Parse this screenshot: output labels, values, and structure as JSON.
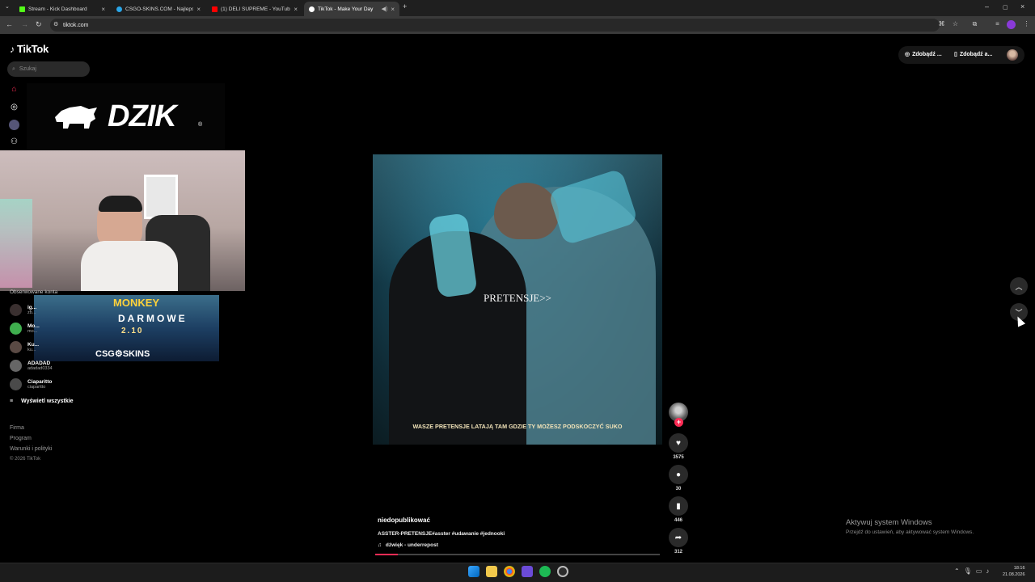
{
  "browser": {
    "tabs": [
      {
        "title": "Stream - Kick Dashboard",
        "color": "#53fc18"
      },
      {
        "title": "CSGO-SKINS.COM - Najlepsze",
        "color": "#2aa6e8"
      },
      {
        "title": "(1) DELI SUPREME - YouTube",
        "color": "#ff0000"
      },
      {
        "title": "TikTok - Make Your Day",
        "color": "#ffffff"
      }
    ],
    "new_tab": "+",
    "url": "tiktok.com"
  },
  "tiktok": {
    "logo": "TikTok",
    "search_placeholder": "Szukaj",
    "followed_label": "Obserwowane konta",
    "accounts": [
      {
        "name": "ig...",
        "handle": "zb..."
      },
      {
        "name": "Mo...",
        "handle": "mo..."
      },
      {
        "name": "Ku...",
        "handle": "ku..."
      },
      {
        "name": "ADADAD",
        "handle": "adadad0334"
      },
      {
        "name": "Ciaparitto",
        "handle": "ciaparitto"
      }
    ],
    "show_all": "Wyświetl wszystkie",
    "footer": {
      "firma": "Firma",
      "program": "Program",
      "terms": "Warunki i polityki",
      "copyright": "© 2026 TikTok"
    },
    "top_buttons": {
      "get_coins": "Zdobądź ...",
      "get_app": "Zdobądź a..."
    }
  },
  "overlays": {
    "dzik": {
      "text": "DZIK",
      "reg": "®"
    },
    "csgo": {
      "top": "MONKEY",
      "darmowe": "DARMOWE",
      "number": "2.10",
      "brand": "CSG⚙SKINS"
    }
  },
  "video": {
    "overlay_text": "PRETENSJE>>",
    "subtitle": "WASZE PRETENSJE LATAJĄ TAM GDZIE TY MOŻESZ PODSKOCZYĆ SUKO",
    "author": "niedopublikować",
    "description": "ASSTER-PRETENSJE#asster #udawanie #jednooki",
    "music": "dźwięk - underrepost",
    "progress_percent": 8,
    "stats": {
      "likes": "3575",
      "comments": "30",
      "saves": "446",
      "shares": "312"
    }
  },
  "windows": {
    "activate_title": "Aktywuj system Windows",
    "activate_sub": "Przejdź do ustawień, aby aktywować system Windows.",
    "time": "18:16",
    "date": "21.08.2026"
  }
}
